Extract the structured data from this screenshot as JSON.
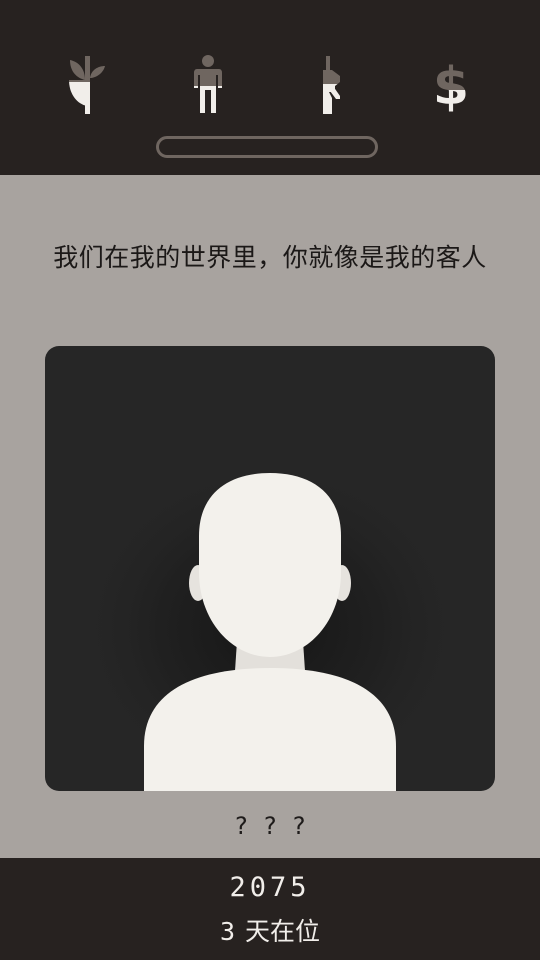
{
  "stats": [
    {
      "id": "religion",
      "icon": "church-plant-icon",
      "level": 0.5
    },
    {
      "id": "people",
      "icon": "people-person-icon",
      "level": 0.5
    },
    {
      "id": "army",
      "icon": "army-rifle-icon",
      "level": 0.5
    },
    {
      "id": "money",
      "icon": "money-dollar-icon",
      "level": 0.5
    }
  ],
  "progress": 0,
  "question_text": "我们在我的世界里，你就像是我的客人",
  "character": {
    "name": "? ? ?",
    "icon": "silhouette-icon"
  },
  "footer": {
    "year": "2075",
    "days": "3",
    "days_label": "天在位"
  },
  "colors": {
    "top_bar": "#272220",
    "background": "#a8a39f",
    "card": "#262626",
    "icon_full": "#f1eeea",
    "icon_empty": "#6f6660"
  }
}
